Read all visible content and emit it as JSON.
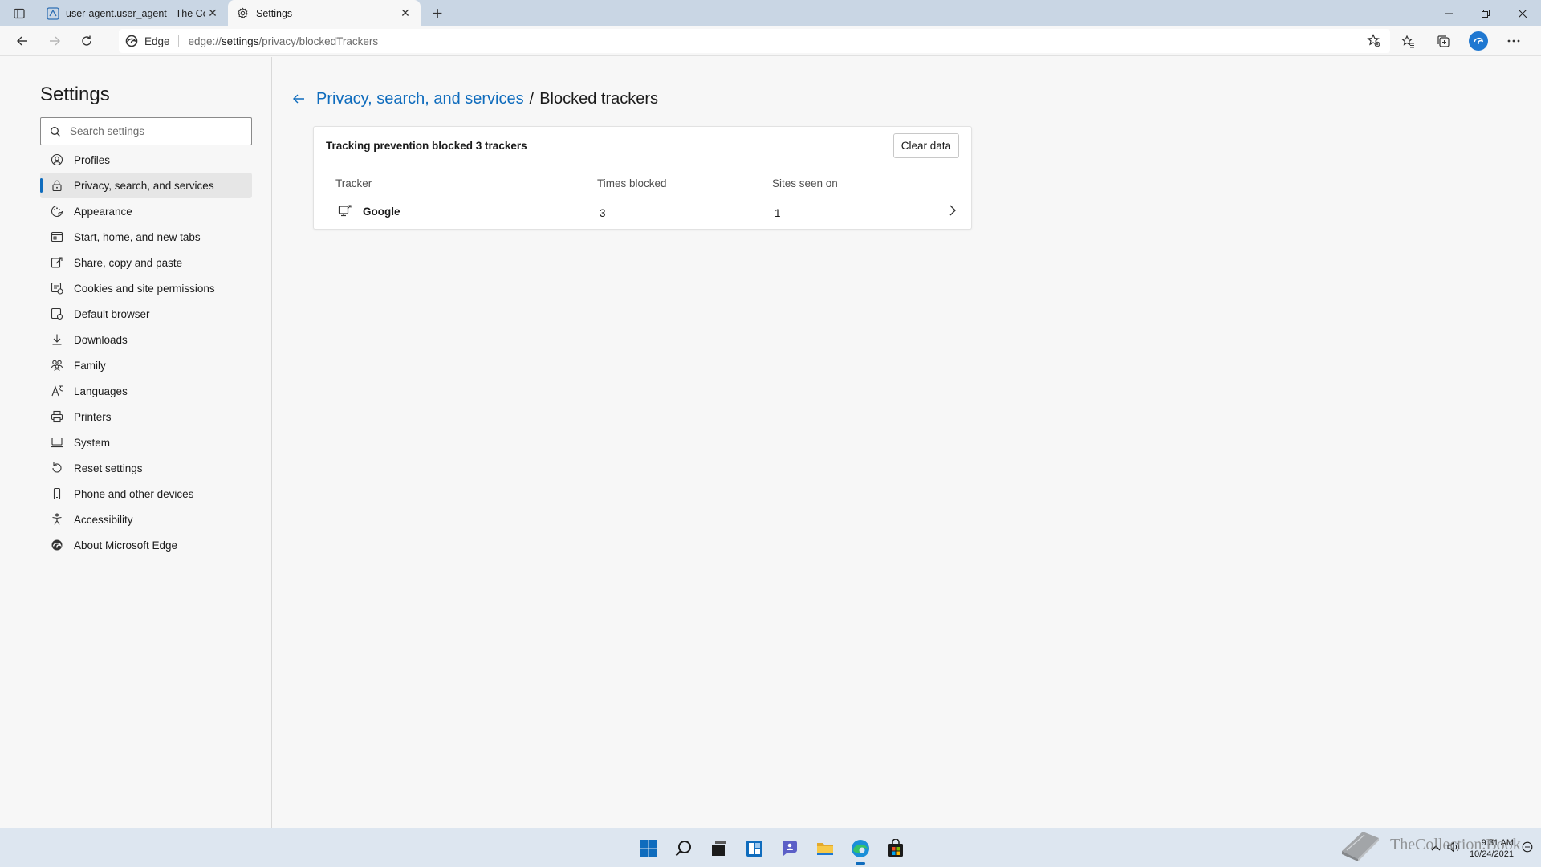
{
  "browser": {
    "tabs": [
      {
        "title": "user-agent.user_agent - The Coll",
        "active": false
      },
      {
        "title": "Settings",
        "active": true
      }
    ],
    "omnibox": {
      "chip_label": "Edge",
      "url_scheme": "edge://",
      "url_host": "settings",
      "url_path": "/privacy/blockedTrackers"
    },
    "colors": {
      "tabstrip": "#c9d6e4",
      "accent": "#0f6cbd"
    }
  },
  "sidebar": {
    "title": "Settings",
    "search_placeholder": "Search settings",
    "items": [
      {
        "label": "Profiles",
        "icon": "profile-icon"
      },
      {
        "label": "Privacy, search, and services",
        "icon": "lock-icon",
        "selected": true
      },
      {
        "label": "Appearance",
        "icon": "appearance-icon"
      },
      {
        "label": "Start, home, and new tabs",
        "icon": "home-tabs-icon"
      },
      {
        "label": "Share, copy and paste",
        "icon": "share-icon"
      },
      {
        "label": "Cookies and site permissions",
        "icon": "cookies-icon"
      },
      {
        "label": "Default browser",
        "icon": "default-browser-icon"
      },
      {
        "label": "Downloads",
        "icon": "download-icon"
      },
      {
        "label": "Family",
        "icon": "family-icon"
      },
      {
        "label": "Languages",
        "icon": "languages-icon"
      },
      {
        "label": "Printers",
        "icon": "printer-icon"
      },
      {
        "label": "System",
        "icon": "system-icon"
      },
      {
        "label": "Reset settings",
        "icon": "reset-icon"
      },
      {
        "label": "Phone and other devices",
        "icon": "phone-icon"
      },
      {
        "label": "Accessibility",
        "icon": "accessibility-icon"
      },
      {
        "label": "About Microsoft Edge",
        "icon": "edge-logo-icon"
      }
    ]
  },
  "main": {
    "breadcrumb_parent": "Privacy, search, and services",
    "breadcrumb_separator": "/",
    "breadcrumb_current": "Blocked trackers",
    "summary": "Tracking prevention blocked 3 trackers",
    "clear_button": "Clear data",
    "columns": {
      "tracker": "Tracker",
      "times_blocked": "Times blocked",
      "sites_seen_on": "Sites seen on"
    },
    "rows": [
      {
        "tracker": "Google",
        "times_blocked": "3",
        "sites_seen_on": "1"
      }
    ]
  },
  "taskbar": {
    "apps": [
      "start-icon",
      "search-icon",
      "task-view-icon",
      "widgets-icon",
      "chat-icon",
      "file-explorer-icon",
      "edge-icon",
      "store-icon"
    ],
    "time": "9:31 AM",
    "date": "10/24/2021",
    "watermark": "TheCollection.Book"
  }
}
